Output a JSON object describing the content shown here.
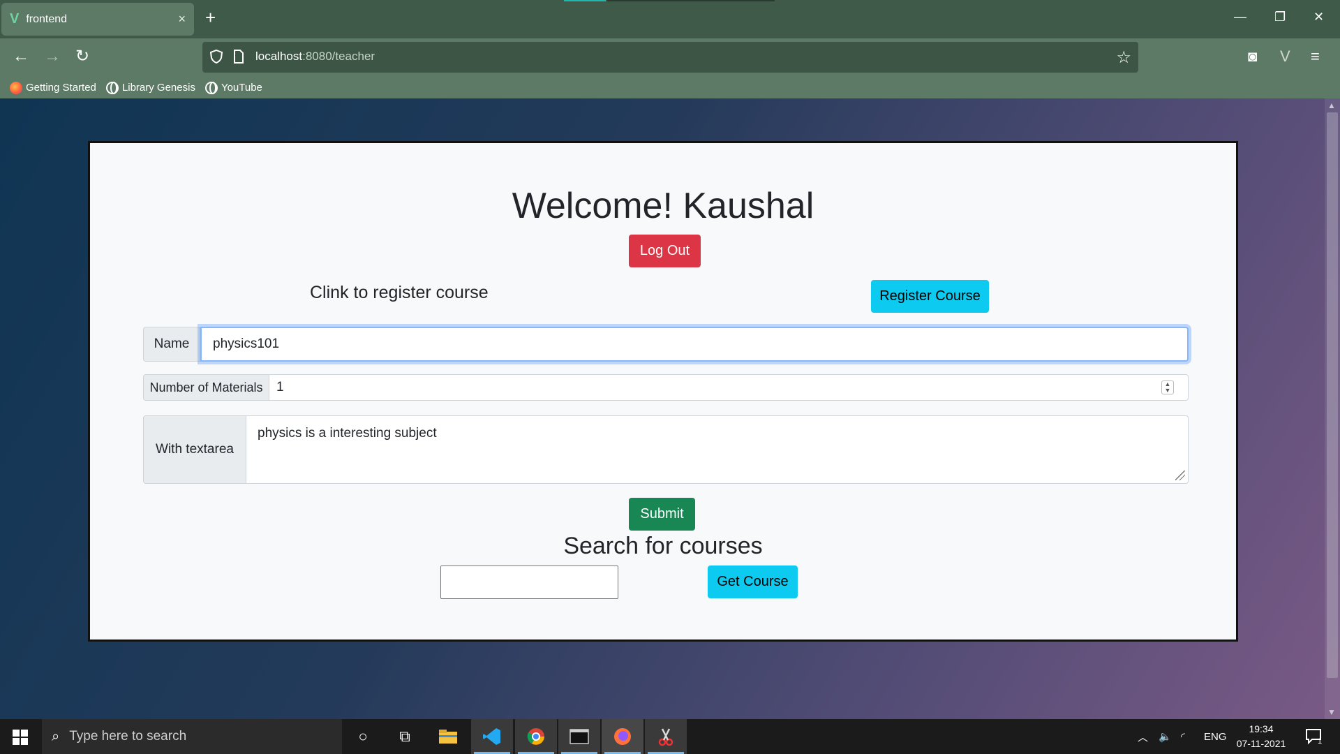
{
  "browser": {
    "tab_title": "frontend",
    "tab_close": "×",
    "new_tab": "+",
    "url_host": "localhost",
    "url_path": ":8080/teacher",
    "bookmarks": [
      {
        "label": "Getting Started",
        "icon": "firefox-icon"
      },
      {
        "label": "Library Genesis",
        "icon": "globe-icon"
      },
      {
        "label": "YouTube",
        "icon": "globe-icon"
      }
    ],
    "window_controls": {
      "minimize": "—",
      "restore": "❐",
      "close": "✕"
    },
    "nav": {
      "back": "←",
      "forward": "→",
      "reload": "↻",
      "star": "☆"
    },
    "right_icons": {
      "pocket": "◙",
      "vue": "V",
      "menu": "≡"
    }
  },
  "page": {
    "welcome": "Welcome! Kaushal",
    "logout_label": "Log Out",
    "register_prompt": "Clink to register course",
    "register_label": "Register Course",
    "form": {
      "name_label": "Name",
      "name_value": "physics101",
      "materials_label": "Number of Materials",
      "materials_value": "1",
      "textarea_label": "With textarea",
      "textarea_value": "physics is a interesting subject"
    },
    "submit_label": "Submit",
    "search_title": "Search for courses",
    "search_value": "",
    "get_course_label": "Get Course"
  },
  "taskbar": {
    "search_placeholder": "Type here to search",
    "apps": [
      "cortana-icon",
      "task-view-icon",
      "file-explorer-icon",
      "vscode-icon",
      "chrome-icon",
      "terminal-icon",
      "firefox-icon",
      "snip-icon"
    ],
    "lang": "ENG",
    "time": "19:34",
    "date": "07-11-2021",
    "notifications": "1"
  },
  "colors": {
    "danger": "#dc3545",
    "info": "#0dcaf0",
    "success": "#198754",
    "chrome": "#5d7a66"
  }
}
